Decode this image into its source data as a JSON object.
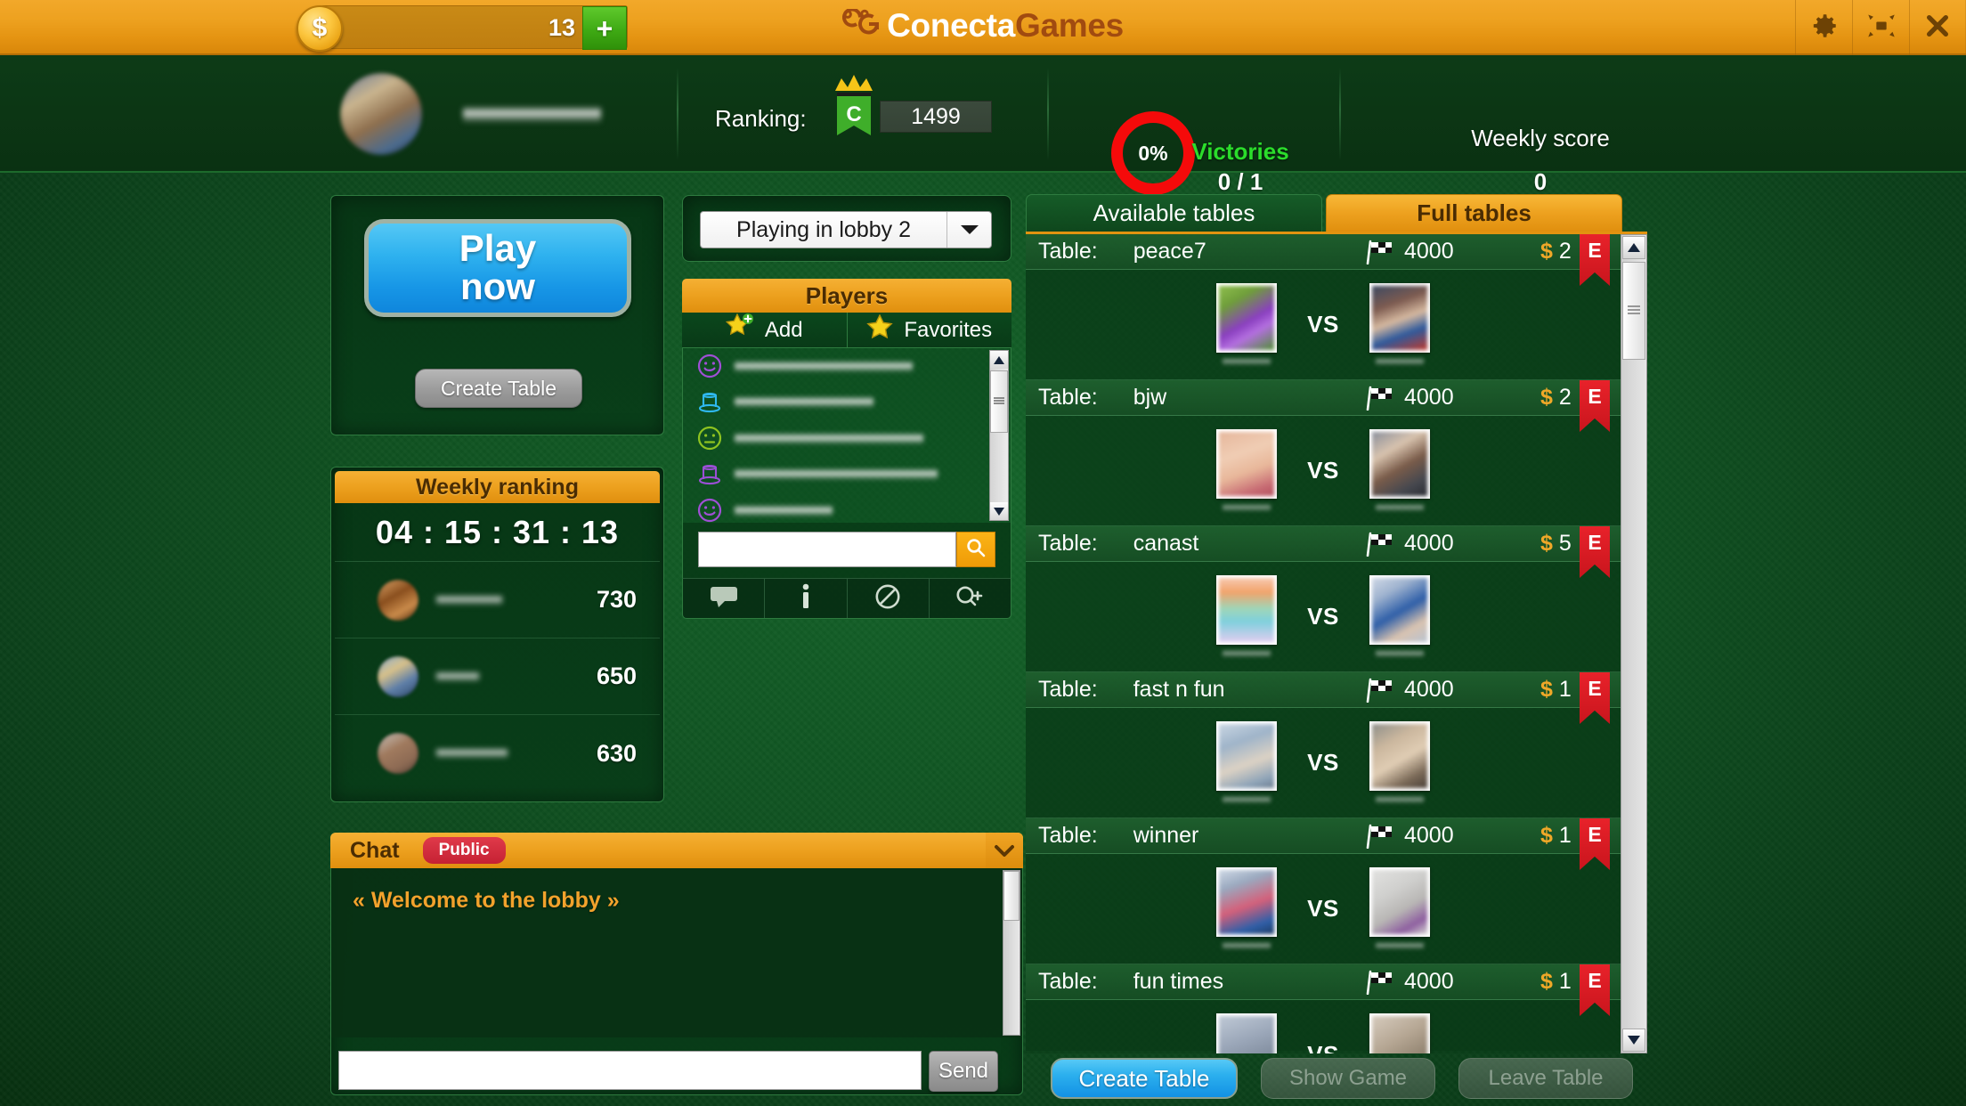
{
  "topbar": {
    "coin_icon": "dollar-coin-icon",
    "coin_count": "13",
    "plus_label": "+",
    "brand_first": "Conecta",
    "brand_second": "Games",
    "settings_icon": "gear-icon",
    "fullscreen_icon": "fullscreen-icon",
    "close_icon": "close-icon"
  },
  "header": {
    "ranking_label": "Ranking:",
    "ranking_badge_letter": "C",
    "ranking_value": "1499",
    "percent": "0%",
    "victories_label": "Victories",
    "victories_value": "0 / 1",
    "weekly_score_label": "Weekly score",
    "weekly_score_value": "0"
  },
  "left": {
    "play_now_label": "Play\nnow",
    "play_now_line1": "Play",
    "play_now_line2": "now",
    "create_table_label": "Create Table",
    "weekly_ranking_title": "Weekly ranking",
    "weekly_timer": "04 : 15 : 31 : 13",
    "ranking_rows": [
      {
        "score": "730"
      },
      {
        "score": "650"
      },
      {
        "score": "630"
      }
    ]
  },
  "chat": {
    "title": "Chat",
    "channel_badge": "Public",
    "collapse_icon": "chevron-down-icon",
    "message": "« Welcome to the lobby »",
    "input_value": "",
    "input_placeholder": "",
    "send_label": "Send"
  },
  "players": {
    "lobby_selected": "Playing in lobby 2",
    "lobby_arrow_icon": "chevron-down-icon",
    "panel_title": "Players",
    "add_label": "Add",
    "add_icon": "star-plus-icon",
    "favorites_label": "Favorites",
    "favorites_icon": "star-icon",
    "rows": [
      {
        "icon": "smiley-icon",
        "color": "#a04fd6",
        "name_width": 200
      },
      {
        "icon": "tophat-icon",
        "color": "#2fb8ef",
        "name_width": 156
      },
      {
        "icon": "neutral-icon",
        "color": "#8fc320",
        "name_width": 212
      },
      {
        "icon": "tophat-icon",
        "color": "#9b4fd6",
        "name_width": 228
      },
      {
        "icon": "smiley-icon",
        "color": "#a04fd6",
        "name_width": 110
      },
      {
        "icon": "tophat-icon",
        "color": "#8fc320",
        "name_width": 214
      },
      {
        "icon": "tophat-icon",
        "color": "#9b4fd6",
        "name_width": 168
      },
      {
        "icon": "smiley-icon",
        "color": "#2fb8ef",
        "name_width": 178
      },
      {
        "icon": "tophat-icon",
        "color": "#2fb8ef",
        "name_width": 162
      },
      {
        "icon": "tophat-icon",
        "color": "#2fb8ef",
        "name_width": 222
      }
    ],
    "search_value": "",
    "search_placeholder": "",
    "search_icon": "magnifier-icon",
    "actions": [
      {
        "icon": "chat-bubble-icon"
      },
      {
        "icon": "info-icon"
      },
      {
        "icon": "block-icon"
      },
      {
        "icon": "magnifier-plus-icon"
      }
    ]
  },
  "tables": {
    "tab_available": "Available tables",
    "tab_full": "Full tables",
    "active_tab": "Full tables",
    "label_table": "Table:",
    "flag_icon": "checkered-flag-icon",
    "currency_symbol": "$",
    "badge_letter": "E",
    "vs_label": "VS",
    "scroll_up_icon": "triangle-up-icon",
    "scroll_down_icon": "triangle-down-icon",
    "rows": [
      {
        "name": "peace7",
        "points": "4000",
        "fee": "2",
        "badge": "E",
        "left_pic": "linear-gradient(150deg,#8fbf4e 0%,#6f9e3a 25%,#8a3fc0 55%,#b46fe0 70%,#4f8f34 100%)",
        "right_pic": "linear-gradient(160deg,#3d4a62 0%,#7d5b50 30%,#d6b9a0 52%,#2f5a9c 72%,#c0392b 100%)"
      },
      {
        "name": "bjw",
        "points": "4000",
        "fee": "2",
        "badge": "E",
        "left_pic": "linear-gradient(160deg,#e6b79c 0%,#f0cdb4 35%,#e8b79a 60%,#c76b73 85%,#b4505e 100%)",
        "right_pic": "linear-gradient(150deg,#8a8f9c 0%,#d8c3ae 30%,#7a5c4a 55%,#46484f 80%,#2b2d33 100%)"
      },
      {
        "name": "canast",
        "points": "4000",
        "fee": "5",
        "badge": "E",
        "left_pic": "linear-gradient(180deg,#f7c9b0 0%,#f2a36b 22%,#9fd6b8 48%,#7fd0dd 68%,#e0cdf0 100%)",
        "right_pic": "linear-gradient(150deg,#cfd8e6 0%,#9fb3cf 25%,#2f5fa8 52%,#d9c3b0 76%,#b9c4d2 100%)"
      },
      {
        "name": "fast n fun",
        "points": "4000",
        "fee": "1",
        "badge": "E",
        "left_pic": "linear-gradient(160deg,#c9d6e3 0%,#9fb4c9 30%,#dcd2c4 60%,#8fa4b8 85%,#6d7f92 100%)",
        "right_pic": "linear-gradient(150deg,#8e8f8a 0%,#cbb79e 30%,#e0cdb4 55%,#7b6a58 80%,#4a4038 100%)"
      },
      {
        "name": "winner",
        "points": "4000",
        "fee": "1",
        "badge": "E",
        "left_pic": "linear-gradient(160deg,#cfd9e6 0%,#9aa9bf 25%,#d4607a 55%,#2f5fa8 82%,#1f3b66 100%)",
        "right_pic": "linear-gradient(150deg,#e2e2e0 0%,#cfcfcd 35%,#b8b6b4 60%,#8e5fa0 82%,#d6d4d2 100%)"
      },
      {
        "name": "fun times",
        "points": "4000",
        "fee": "1",
        "badge": "E",
        "left_pic": "linear-gradient(160deg,#bfc9d6 0%,#9aa6b8 40%,#7c8899 75%,#5e6a7a 100%)",
        "right_pic": "linear-gradient(150deg,#d6cbbd 0%,#b5a693 40%,#8d7f6c 75%,#6a5d4c 100%)"
      }
    ],
    "create_table_label": "Create Table",
    "show_game_label": "Show Game",
    "leave_table_label": "Leave Table"
  },
  "colors": {
    "orange": "#eda11f",
    "green_bg": "#0f5020",
    "blue_button": "#2cb0ee",
    "red_ribbon": "#c9151d",
    "victories_green": "#2bdd2b"
  }
}
